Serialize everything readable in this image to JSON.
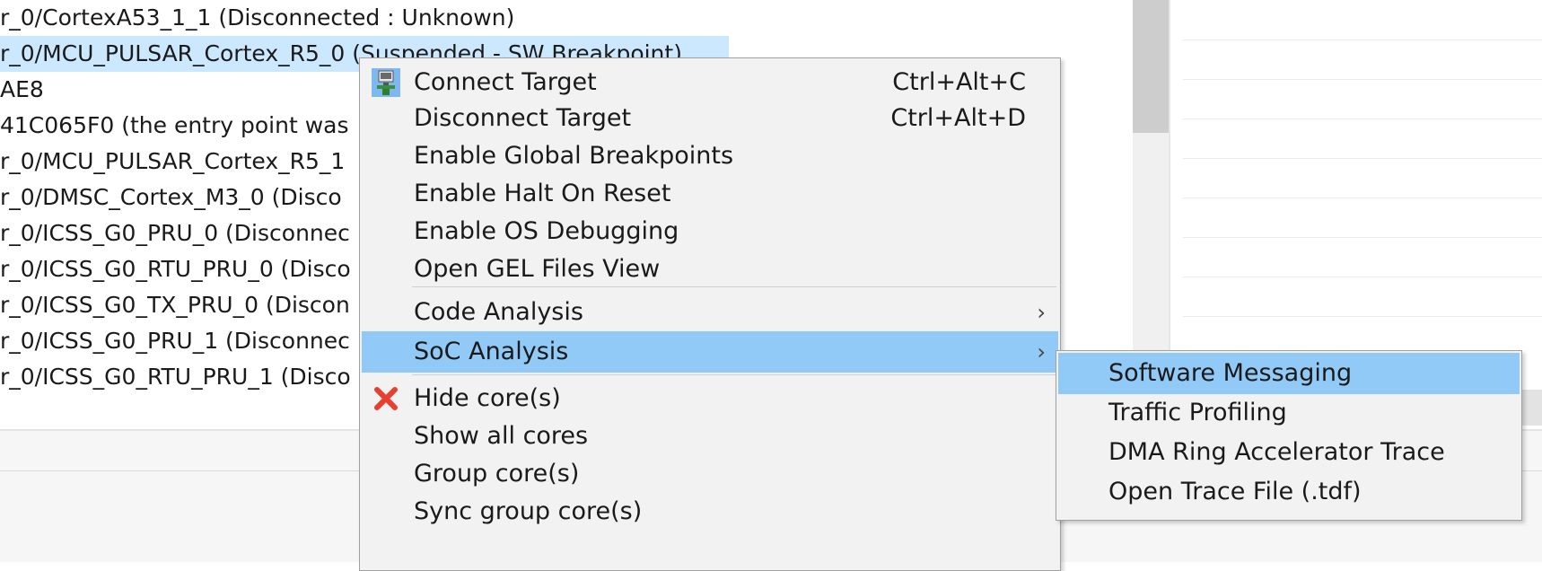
{
  "debug_tree": {
    "rows": [
      "r_0/CortexA53_1_1 (Disconnected : Unknown)",
      "r_0/MCU_PULSAR_Cortex_R5_0 (Suspended - SW Breakpoint)",
      "AE8",
      "41C065F0  (the entry point was",
      "r_0/MCU_PULSAR_Cortex_R5_1",
      "r_0/DMSC_Cortex_M3_0 (Disco",
      "r_0/ICSS_G0_PRU_0 (Disconnec",
      "r_0/ICSS_G0_RTU_PRU_0 (Disco",
      "r_0/ICSS_G0_TX_PRU_0 (Discon",
      "r_0/ICSS_G0_PRU_1 (Disconnec",
      "r_0/ICSS_G0_RTU_PRU_1 (Disco"
    ]
  },
  "context_menu": {
    "items": [
      {
        "label": "Connect Target",
        "accel": "Ctrl+Alt+C",
        "icon": "connect-target-icon"
      },
      {
        "label": "Disconnect Target",
        "accel": "Ctrl+Alt+D"
      },
      {
        "label": "Enable Global Breakpoints"
      },
      {
        "label": "Enable Halt On Reset"
      },
      {
        "label": "Enable OS Debugging"
      },
      {
        "label": "Open GEL Files View"
      },
      {
        "label": "Code Analysis",
        "submenu": true
      },
      {
        "label": "SoC Analysis",
        "submenu": true
      },
      {
        "label": "Hide core(s)",
        "icon": "red-x-icon"
      },
      {
        "label": "Show all cores"
      },
      {
        "label": "Group core(s)"
      },
      {
        "label": "Sync group core(s)"
      }
    ],
    "arrow_glyph": "›"
  },
  "soc_submenu": {
    "items": [
      {
        "label": "Software Messaging"
      },
      {
        "label": "Traffic Profiling"
      },
      {
        "label": "DMA Ring Accelerator Trace"
      },
      {
        "label": "Open Trace File (.tdf)"
      }
    ]
  },
  "colors": {
    "highlight": "#91c9f7",
    "selection": "#cce8ff",
    "menu_bg": "#f2f2f2"
  }
}
